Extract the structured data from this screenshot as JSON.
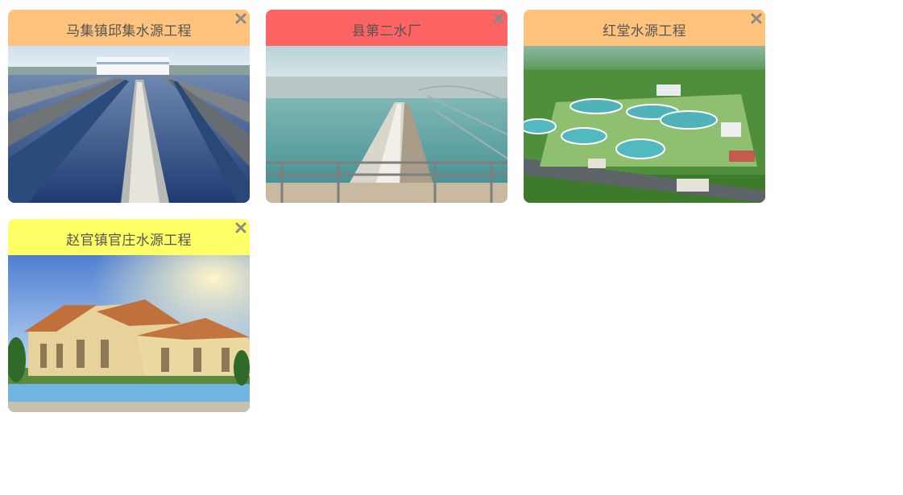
{
  "colors": {
    "orange": "#FFC37D",
    "red": "#FF6464",
    "yellow": "#FFFF66",
    "title_text": "#555555",
    "close_icon": "#8A8A8A"
  },
  "cards": [
    {
      "title": "马集镇邱集水源工程",
      "header_color": "#FFC37D",
      "image": "water-treatment-tanks-image"
    },
    {
      "title": "县第二水厂",
      "header_color": "#FF6464",
      "image": "water-plant-walkway-image"
    },
    {
      "title": "红堂水源工程",
      "header_color": "#FFC37D",
      "image": "aerial-plant-rendering-image"
    },
    {
      "title": "赵官镇官庄水源工程",
      "header_color": "#FFFF66",
      "image": "villa-rendering-image"
    }
  ]
}
